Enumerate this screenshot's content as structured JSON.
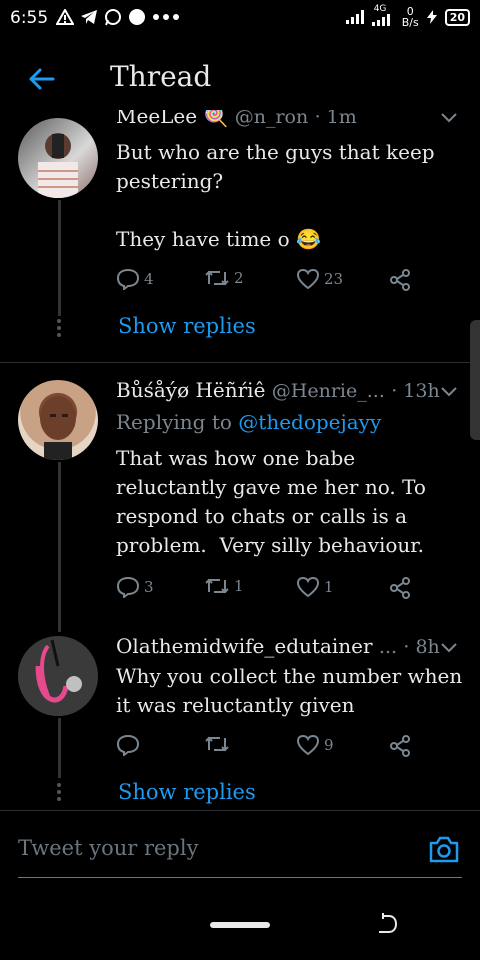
{
  "status_bar": {
    "time": "6:55",
    "network": "4G",
    "speed_value": "0",
    "speed_unit": "B/s",
    "battery": "20"
  },
  "header": {
    "title": "Thread"
  },
  "tweets": [
    {
      "name": "MeeLee 🍭",
      "handle": "@n_ron",
      "time": "· 1m",
      "body": "But who are the guys that keep pestering?\n\nThey have time o 😂",
      "replies": "4",
      "retweets": "2",
      "likes": "23",
      "show_replies": "Show replies"
    },
    {
      "name": "Bůśåýø Hëñŕiê",
      "handle": "@Henrie_...",
      "time": "· 13h",
      "replying_label": "Replying to",
      "replying_handle": "@thedopejayy",
      "body": "That was how one babe reluctantly gave me her no. To respond to chats or calls is a problem.  Very silly behaviour.",
      "replies": "3",
      "retweets": "1",
      "likes": "1"
    },
    {
      "name": "Olathemidwife_edutainer",
      "handle": "...",
      "time": "· 8h",
      "body": "Why you collect the number when it was reluctantly given",
      "replies": "",
      "retweets": "",
      "likes": "9",
      "show_replies": "Show replies"
    }
  ],
  "reply_bar": {
    "placeholder": "Tweet your reply"
  },
  "colors": {
    "accent": "#1d9bf0",
    "background": "#000000",
    "muted": "#7a8690"
  }
}
